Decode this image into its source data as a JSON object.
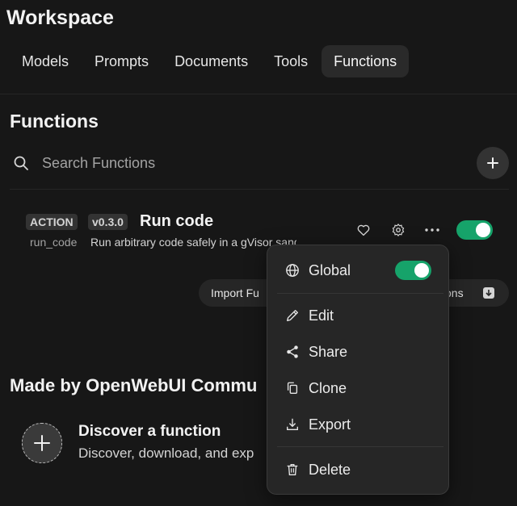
{
  "header": {
    "title": "Workspace"
  },
  "tabs": [
    {
      "label": "Models"
    },
    {
      "label": "Prompts"
    },
    {
      "label": "Documents"
    },
    {
      "label": "Tools"
    },
    {
      "label": "Functions",
      "active": true
    }
  ],
  "section": {
    "title": "Functions"
  },
  "search": {
    "placeholder": "Search Functions",
    "value": "",
    "icon": "search-icon"
  },
  "function_item": {
    "type_badge": "ACTION",
    "version_badge": "v0.3.0",
    "name": "Run code",
    "id": "run_code",
    "description": "Run arbitrary code safely in a gVisor sandbox",
    "enabled": true
  },
  "import_bar": {
    "import_label": "Import Fu",
    "export_label": "ons"
  },
  "community": {
    "title": "Made by OpenWebUI Commu",
    "discover_title": "Discover a function",
    "discover_desc": "Discover, download, and exp"
  },
  "context_menu": {
    "global_label": "Global",
    "global_enabled": true,
    "items": [
      {
        "label": "Edit",
        "icon": "pencil-icon"
      },
      {
        "label": "Share",
        "icon": "share-icon"
      },
      {
        "label": "Clone",
        "icon": "copy-icon"
      },
      {
        "label": "Export",
        "icon": "download-icon"
      }
    ],
    "delete_label": "Delete"
  },
  "colors": {
    "background": "#171717",
    "toggle_on": "#16a36a",
    "menu_bg": "#262626"
  }
}
